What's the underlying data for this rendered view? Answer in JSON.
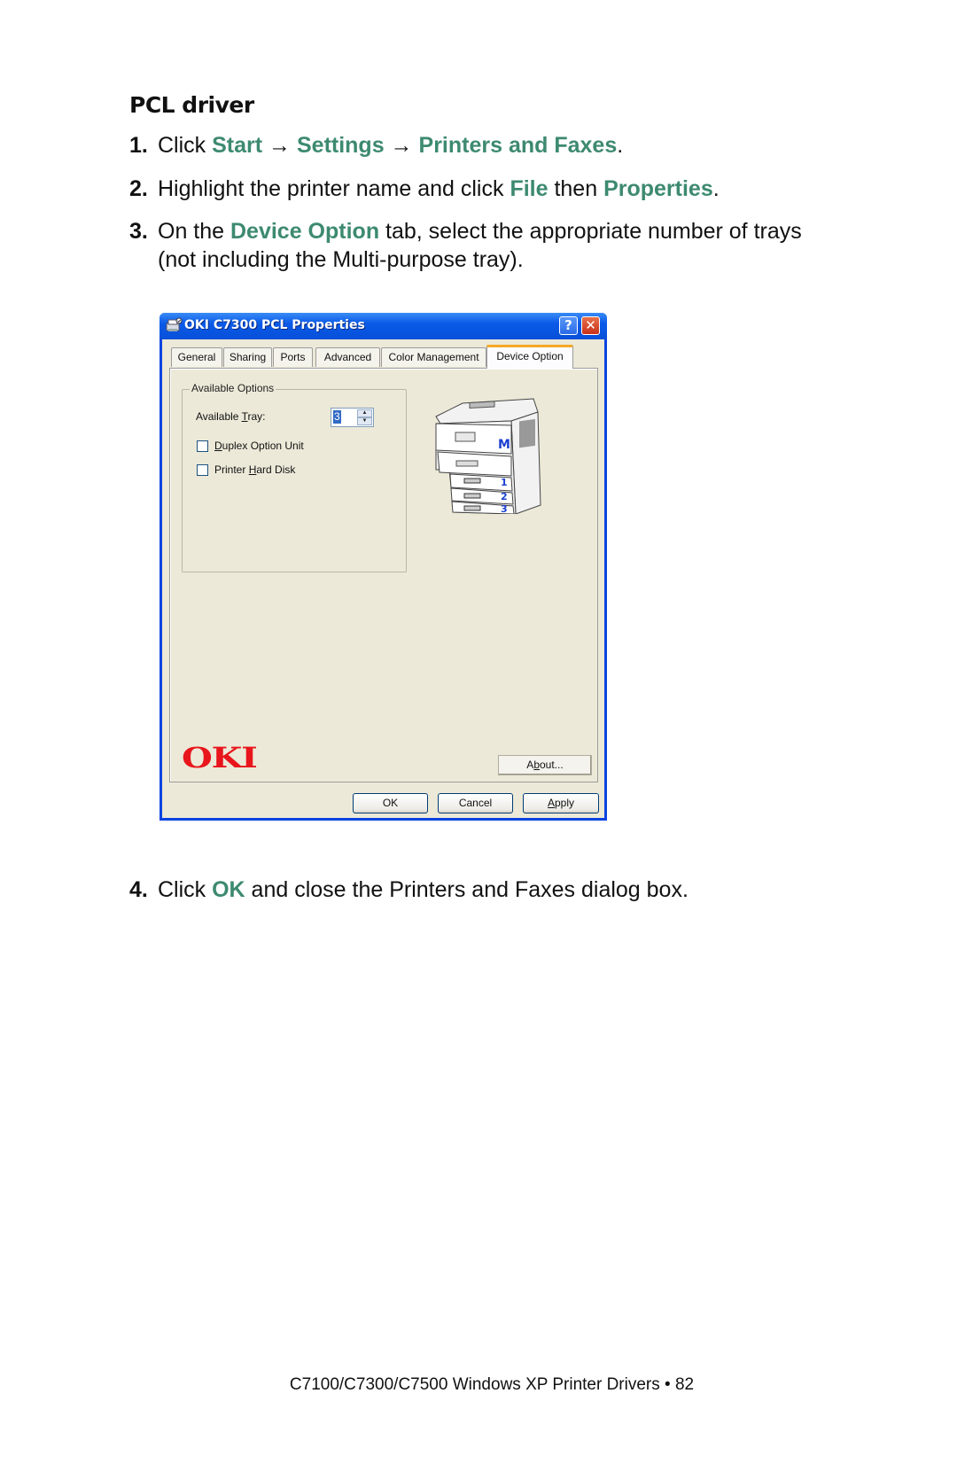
{
  "heading": "PCL driver",
  "steps": [
    {
      "num": "1.",
      "parts": {
        "a": "Click ",
        "b": "Start",
        "c": " → ",
        "d": "Settings",
        "e": " → ",
        "f": "Printers and Faxes",
        "g": "."
      }
    },
    {
      "num": "2.",
      "parts": {
        "a": "Highlight the printer name and click ",
        "b": "File",
        "c": " then ",
        "d": "Properties",
        "e": "."
      }
    },
    {
      "num": "3.",
      "parts": {
        "a": "On the ",
        "b": "Device Option",
        "c": " tab, select the appropriate number of trays",
        "d": "(not including the Multi-purpose tray)."
      }
    },
    {
      "num": "4.",
      "parts": {
        "a": "Click ",
        "b": "OK",
        "c": " and close the Printers and Faxes dialog box."
      }
    }
  ],
  "dialog": {
    "title": "OKI C7300 PCL Properties",
    "title_icon": "printer-icon",
    "help_label": "?",
    "close_label": "✕",
    "tabs": [
      {
        "label": "General",
        "active": false
      },
      {
        "label": "Sharing",
        "active": false
      },
      {
        "label": "Ports",
        "active": false
      },
      {
        "label": "Advanced",
        "active": false
      },
      {
        "label": "Color Management",
        "active": false
      },
      {
        "label": "Device Option",
        "active": true
      }
    ],
    "group_title": "Available Options",
    "available_tray": {
      "label_pre": "Available ",
      "label_u": "T",
      "label_post": "ray:",
      "value": "3"
    },
    "duplex": {
      "label_u": "D",
      "label_post": "uplex Option Unit",
      "checked": false
    },
    "hard_disk": {
      "label_pre": "Printer ",
      "label_u": "H",
      "label_post": "ard Disk",
      "checked": false
    },
    "printer_labels": {
      "mp": "M",
      "t1": "1",
      "t2": "2",
      "t3": "3"
    },
    "brand_logo": "OKI",
    "about": {
      "pre": "A",
      "u": "b",
      "post": "out..."
    },
    "ok": "OK",
    "cancel": "Cancel",
    "apply": {
      "u": "A",
      "post": "pply"
    }
  },
  "footer": "C7100/C7300/C7500 Windows XP Printer Drivers • 82",
  "colors": {
    "accent_green": "#3d8a70",
    "xp_blue": "#0a44e0",
    "oki_red": "#e8161c"
  }
}
